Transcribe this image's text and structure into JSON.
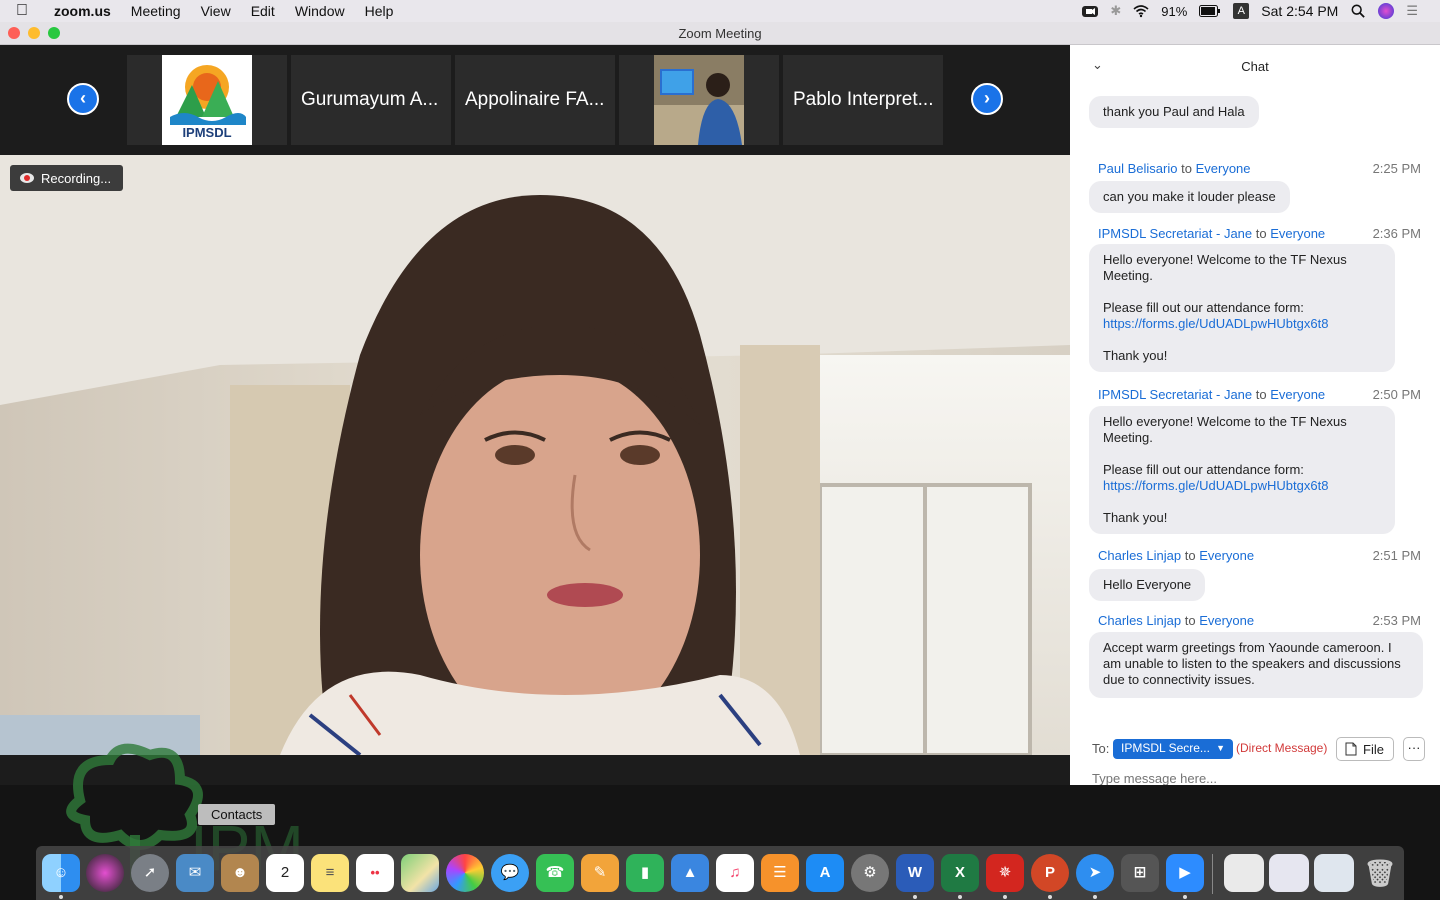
{
  "menubar": {
    "app": "zoom.us",
    "items": [
      "Meeting",
      "View",
      "Edit",
      "Window",
      "Help"
    ],
    "battery": "91%",
    "input_source": "A",
    "clock": "Sat 2:54 PM"
  },
  "window": {
    "title": "Zoom Meeting"
  },
  "gallery": {
    "tiles": [
      {
        "label": "",
        "logo_text": "IPMSDL"
      },
      {
        "label": "Gurumayum A..."
      },
      {
        "label": "Appolinaire FA..."
      },
      {
        "label": ""
      },
      {
        "label": "Pablo Interpret..."
      }
    ]
  },
  "video": {
    "recording_label": "Recording..."
  },
  "chat": {
    "title": "Chat",
    "messages": [
      {
        "text": "thank you Paul and Hala"
      },
      {
        "sender": "Paul Belisario",
        "to_word": "to",
        "recipient": "Everyone",
        "time": "2:25 PM",
        "text": "can you make it louder please"
      },
      {
        "sender": "IPMSDL Secretariat - Jane",
        "to_word": "to",
        "recipient": "Everyone",
        "time": "2:36 PM",
        "line1": "Hello everyone! Welcome to the TF Nexus Meeting.",
        "line2": "Please fill out our attendance form:",
        "link": "https://forms.gle/UdUADLpwHUbtgx6t8",
        "line3": "Thank you!"
      },
      {
        "sender": "IPMSDL Secretariat - Jane",
        "to_word": "to",
        "recipient": "Everyone",
        "time": "2:50 PM",
        "line1": "Hello everyone! Welcome to the TF Nexus Meeting.",
        "line2": "Please fill out our attendance form:",
        "link": "https://forms.gle/UdUADLpwHUbtgx6t8",
        "line3": "Thank you!"
      },
      {
        "sender": "Charles Linjap",
        "to_word": "to",
        "recipient": "Everyone",
        "time": "2:51 PM",
        "text": "Hello Everyone"
      },
      {
        "sender": "Charles Linjap",
        "to_word": "to",
        "recipient": "Everyone",
        "time": "2:53 PM",
        "text": "Accept warm greetings from Yaounde cameroon. I am unable to listen to the speakers and discussions due to connectivity issues."
      }
    ],
    "compose": {
      "to_label": "To:",
      "recipient": "IPMSDL Secre...",
      "direct_message": "(Direct Message)",
      "file_label": "File",
      "more_label": "···",
      "placeholder": "Type message here..."
    }
  },
  "desktop": {
    "tooltip": "Contacts",
    "calendar_day": "2"
  },
  "colors": {
    "accent": "#1a6dd6",
    "recording_red": "#e02b2b",
    "dm_red": "#d23a3a"
  }
}
